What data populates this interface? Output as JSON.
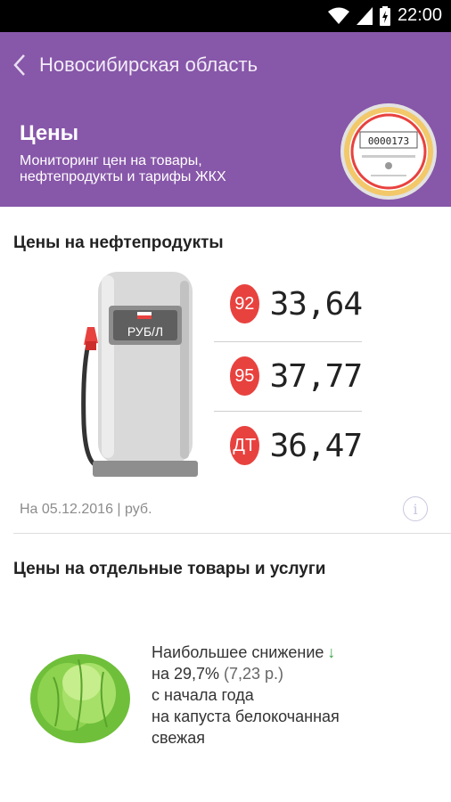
{
  "status_bar": {
    "time": "22:00"
  },
  "app_bar": {
    "title": "Новосибирская область"
  },
  "hero": {
    "title": "Цены",
    "subtitle_line1": "Мониторинг цен на товары,",
    "subtitle_line2": "нефтепродукты и тарифы ЖКХ",
    "meter_reading": "0000173"
  },
  "fuel_section": {
    "title": "Цены на нефтепродукты",
    "pump_label": "РУБ/Л",
    "prices": [
      {
        "grade": "92",
        "price": "33,64"
      },
      {
        "grade": "95",
        "price": "37,77"
      },
      {
        "grade": "ДТ",
        "price": "36,47"
      }
    ],
    "date_note": "На 05.12.2016 | руб."
  },
  "goods_section": {
    "title": "Цены на отдельные товары и услуги",
    "headline": "Наибольшее снижение",
    "change": "на 29,7%",
    "change_abs": "(7,23 р.)",
    "period": "с начала года",
    "item_prefix": "на",
    "item_line1": "капуста белокочанная",
    "item_line2": "свежая"
  },
  "colors": {
    "brand": "#8757a9",
    "badge": "#e8423f",
    "down": "#3aa24a"
  }
}
